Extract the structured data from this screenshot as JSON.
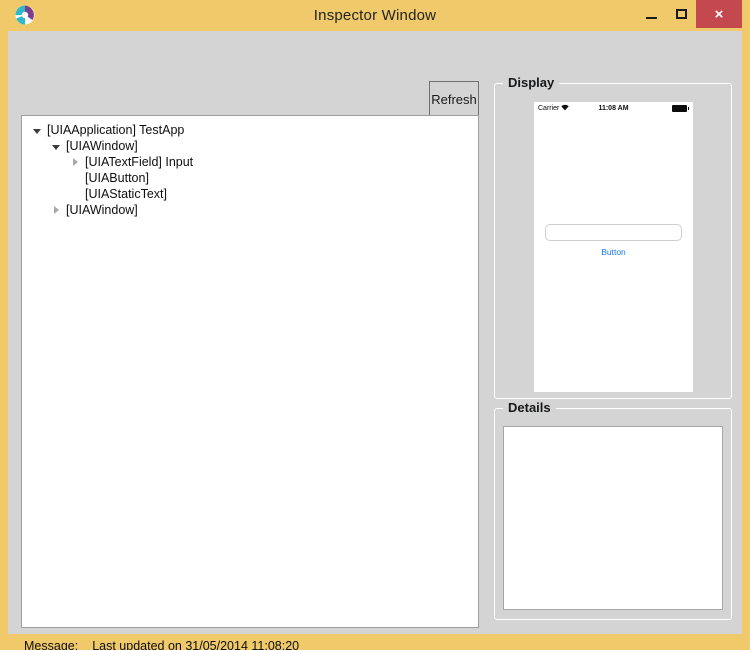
{
  "window": {
    "title": "Inspector Window",
    "icon": "swirl-logo-icon",
    "colors": {
      "title_bar": "#efc96a",
      "client_background": "#d4d4d4",
      "close_button": "#c4494f",
      "accent_blue": "#1a7aef"
    },
    "controls": {
      "minimize": "minimize-icon",
      "maximize": "maximize-icon",
      "close": "×"
    }
  },
  "toolbar": {
    "refresh_label": "Refresh"
  },
  "tree": {
    "nodes": [
      {
        "label": "[UIAApplication] TestApp",
        "indent": 0,
        "state": "expanded"
      },
      {
        "label": "[UIAWindow]",
        "indent": 1,
        "state": "expanded"
      },
      {
        "label": "[UIATextField] Input",
        "indent": 2,
        "state": "collapsed"
      },
      {
        "label": "[UIAButton]",
        "indent": 2,
        "state": "leaf"
      },
      {
        "label": "[UIAStaticText]",
        "indent": 2,
        "state": "leaf"
      },
      {
        "label": "[UIAWindow]",
        "indent": 1,
        "state": "collapsed"
      }
    ]
  },
  "display_group": {
    "title": "Display",
    "phone": {
      "statusbar": {
        "carrier": "Carrier",
        "wifi": "wifi-icon",
        "time": "11:08 AM",
        "battery": "battery-icon"
      },
      "textfield_value": "",
      "button_label": "Button"
    }
  },
  "details_group": {
    "title": "Details",
    "content": ""
  },
  "statusbar": {
    "label": "Message:",
    "message": "Last updated on 31/05/2014 11:08:20"
  }
}
